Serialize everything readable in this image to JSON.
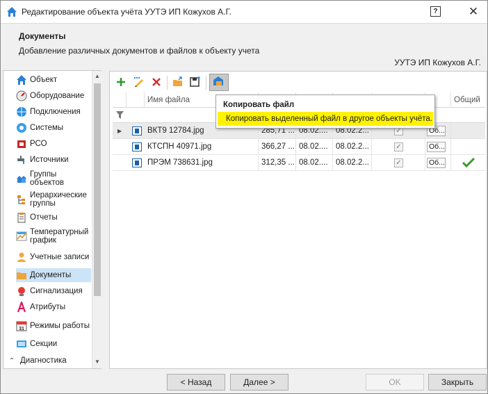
{
  "window": {
    "title": "Редактирование объекта учёта УУТЭ ИП Кожухов А.Г.",
    "help": "?",
    "close": "✕"
  },
  "header": {
    "title": "Документы",
    "subtitle": "Добавление различных документов и файлов к объекту учета",
    "object_name": "УУТЭ ИП Кожухов А.Г."
  },
  "sidebar": {
    "items": [
      {
        "label": "Объект",
        "icon": "house-icon"
      },
      {
        "label": "Оборудование",
        "icon": "gauge-icon"
      },
      {
        "label": "Подключения",
        "icon": "globe-icon"
      },
      {
        "label": "Системы",
        "icon": "systems-icon"
      },
      {
        "label": "РСО",
        "icon": "rso-icon"
      },
      {
        "label": "Источники",
        "icon": "tap-icon"
      },
      {
        "label": "Группы объектов",
        "icon": "group-icon"
      },
      {
        "label": "Иерархические группы",
        "icon": "hierarchy-icon"
      },
      {
        "label": "Отчеты",
        "icon": "clipboard-icon"
      },
      {
        "label": "Температурный график",
        "icon": "chart-icon"
      },
      {
        "label": "Учетные записи",
        "icon": "user-icon"
      },
      {
        "label": "Документы",
        "icon": "folder-icon"
      },
      {
        "label": "Сигнализация",
        "icon": "alarm-icon"
      },
      {
        "label": "Атрибуты",
        "icon": "letter-a-icon"
      },
      {
        "label": "Режимы работы",
        "icon": "calendar-icon"
      },
      {
        "label": "Секции",
        "icon": "section-icon"
      },
      {
        "label": "Диагностика",
        "icon": "chevron-up-icon"
      }
    ],
    "selected": "Документы",
    "calendar_day": "31"
  },
  "grid": {
    "columns": [
      "Имя файла",
      "Общий"
    ],
    "rows": [
      {
        "name": "ВКТ9 12784.jpg",
        "size": "285,71 ...",
        "date1": "08.02....",
        "date2": "08.02.2...",
        "checked": true,
        "obj": "Об...",
        "shared": false
      },
      {
        "name": "КТСПН 40971.jpg",
        "size": "366,27 ...",
        "date1": "08.02....",
        "date2": "08.02.2...",
        "checked": true,
        "obj": "Об...",
        "shared": false
      },
      {
        "name": "ПРЭМ 738631.jpg",
        "size": "312,35 ...",
        "date1": "08.02....",
        "date2": "08.02.2...",
        "checked": true,
        "obj": "Об...",
        "shared": true
      }
    ]
  },
  "toolbar": {
    "buttons": [
      "add-icon",
      "edit-icon",
      "delete-icon",
      "open-folder-icon",
      "save-icon",
      "copy-file-icon"
    ]
  },
  "tooltip": {
    "title": "Копировать файл",
    "body": "Копировать выделенный файл в другое объекты учёта."
  },
  "footer": {
    "back": "< Назад",
    "next": "Далее >",
    "ok": "OK",
    "close": "Закрыть"
  },
  "colors": {
    "selection": "#cce4f7",
    "tooltip_highlight": "#fef200",
    "accent": "#1b5fa8"
  }
}
